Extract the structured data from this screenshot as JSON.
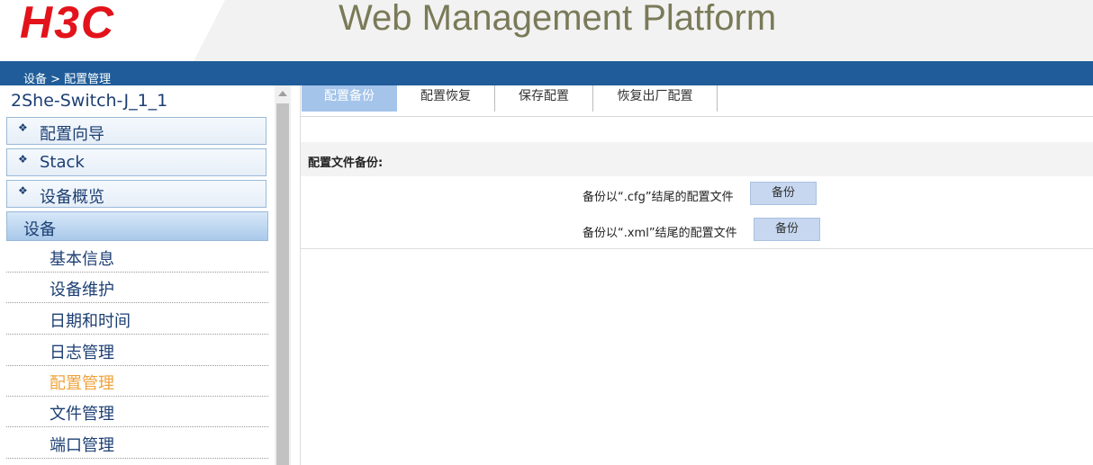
{
  "header": {
    "logo_text": "H3C",
    "title": "Web Management Platform",
    "colors": {
      "logo": "#e3131b",
      "title": "#7a7a58",
      "bar": "#1f5c99"
    }
  },
  "breadcrumb": "设备 > 配置管理",
  "sidebar": {
    "device_name": "2She-Switch-J_1_1",
    "top_items": [
      {
        "label": "配置向导",
        "icon": "diamond-icon"
      },
      {
        "label": "Stack",
        "icon": "diamond-icon"
      },
      {
        "label": "设备概览",
        "icon": "diamond-icon"
      }
    ],
    "category": "设备",
    "sub_items": [
      {
        "label": "基本信息"
      },
      {
        "label": "设备维护"
      },
      {
        "label": "日期和时间"
      },
      {
        "label": "日志管理"
      },
      {
        "label": "配置管理",
        "active": true
      },
      {
        "label": "文件管理"
      },
      {
        "label": "端口管理"
      }
    ]
  },
  "tabs": [
    {
      "label": "配置备份",
      "active": true
    },
    {
      "label": "配置恢复"
    },
    {
      "label": "保存配置"
    },
    {
      "label": "恢复出厂配置"
    }
  ],
  "backup": {
    "section_title": "配置文件备份:",
    "rows": [
      {
        "label": "备份以“.cfg”结尾的配置文件",
        "button": "备份"
      },
      {
        "label": "备份以“.xml”结尾的配置文件",
        "button": "备份"
      }
    ]
  }
}
